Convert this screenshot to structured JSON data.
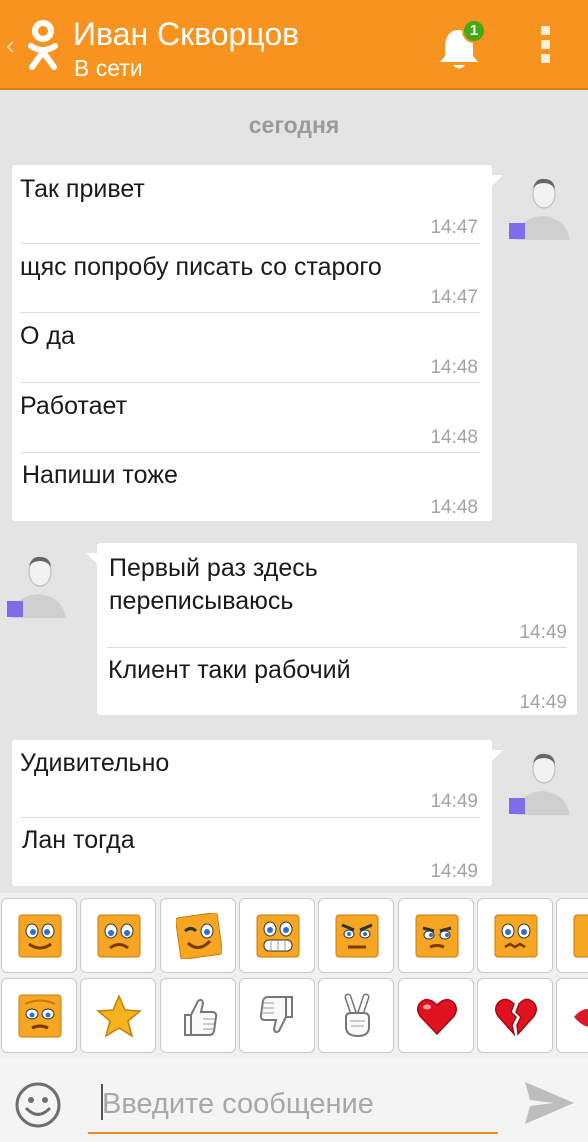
{
  "header": {
    "contact_name": "Иван Скворцов",
    "status": "В сети",
    "notification_count": "1"
  },
  "day_label": "сегодня",
  "groups": [
    {
      "side": "right",
      "messages": [
        {
          "text": "Так привет",
          "time": "14:47"
        },
        {
          "text": "щяс попробу писать со старого",
          "time": "14:47"
        },
        {
          "text": "О да",
          "time": "14:48"
        },
        {
          "text": "Работает",
          "time": "14:48"
        },
        {
          "text": "Напиши тоже",
          "time": "14:48"
        }
      ]
    },
    {
      "side": "left",
      "messages": [
        {
          "text": "Первый раз здесь\nпереписываюсь",
          "time": "14:49"
        },
        {
          "text": "Клиент таки рабочий",
          "time": "14:49"
        }
      ]
    },
    {
      "side": "right",
      "messages": [
        {
          "text": "Удивительно",
          "time": "14:49"
        },
        {
          "text": "Лан тогда",
          "time": "14:49"
        }
      ]
    }
  ],
  "emoji_rows": [
    [
      "smile-face-icon",
      "sad-face-icon",
      "wink-face-icon",
      "grin-face-icon",
      "angry-face-icon",
      "suspicious-face-icon",
      "worried-face-icon",
      "smirk-face-icon"
    ],
    [
      "frown-face-icon",
      "star-icon",
      "thumbs-up-icon",
      "thumbs-down-icon",
      "victory-hand-icon",
      "heart-icon",
      "broken-heart-icon",
      "lips-icon"
    ]
  ],
  "input": {
    "placeholder": "Введите сообщение",
    "value": ""
  },
  "colors": {
    "header": "#f7931e",
    "accent": "#f28a1c",
    "badge": "#44a817",
    "status_square": "#7b6ee8"
  }
}
